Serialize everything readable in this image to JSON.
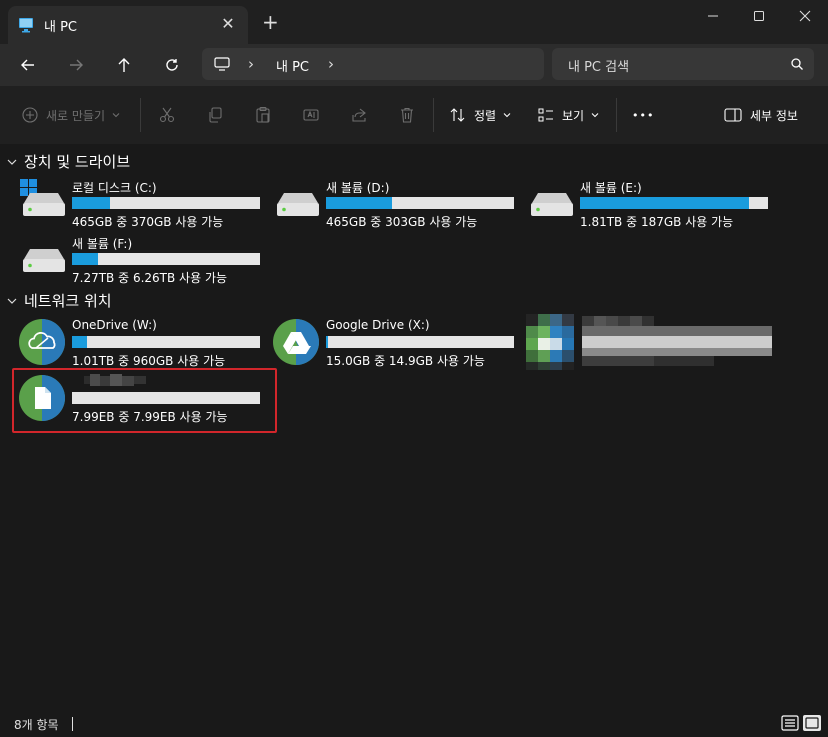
{
  "window": {
    "tab_title": "내 PC",
    "tab_close": "✕",
    "new_tab": "+",
    "minimize": "—",
    "maximize": "☐",
    "close": "✕"
  },
  "nav": {
    "breadcrumb": "내 PC",
    "breadcrumb_sep": "›",
    "search_placeholder": "내 PC 검색"
  },
  "toolbar": {
    "new_label": "새로 만들기",
    "sort_label": "정렬",
    "view_label": "보기",
    "more_label": "•••",
    "details_label": "세부 정보"
  },
  "sections": {
    "devices": "장치 및 드라이브",
    "network": "네트워크 위치"
  },
  "drives": [
    {
      "name": "로컬 디스크 (C:)",
      "info": "465GB 중 370GB 사용 가능",
      "used_fraction": 0.2
    },
    {
      "name": "새 볼륨 (D:)",
      "info": "465GB 중 303GB 사용 가능",
      "used_fraction": 0.35
    },
    {
      "name": "새 볼륨 (E:)",
      "info": "1.81TB 중 187GB 사용 가능",
      "used_fraction": 0.9
    },
    {
      "name": "새 볼륨 (F:)",
      "info": "7.27TB 중 6.26TB 사용 가능",
      "used_fraction": 0.14
    }
  ],
  "network_drives": [
    {
      "name": "OneDrive (W:)",
      "info": "1.01TB 중 960GB 사용 가능",
      "used_fraction": 0.08
    },
    {
      "name": "Google Drive (X:)",
      "info": "15.0GB 중 14.9GB 사용 가능",
      "used_fraction": 0.01
    },
    {
      "name": "",
      "info": "7.99EB 중 7.99EB 사용 가능",
      "used_fraction": 0.0
    }
  ],
  "status": {
    "item_count": "8개 항목"
  },
  "colors": {
    "accent": "#1a9cdd",
    "highlight": "#d2262b",
    "background": "#191919"
  }
}
